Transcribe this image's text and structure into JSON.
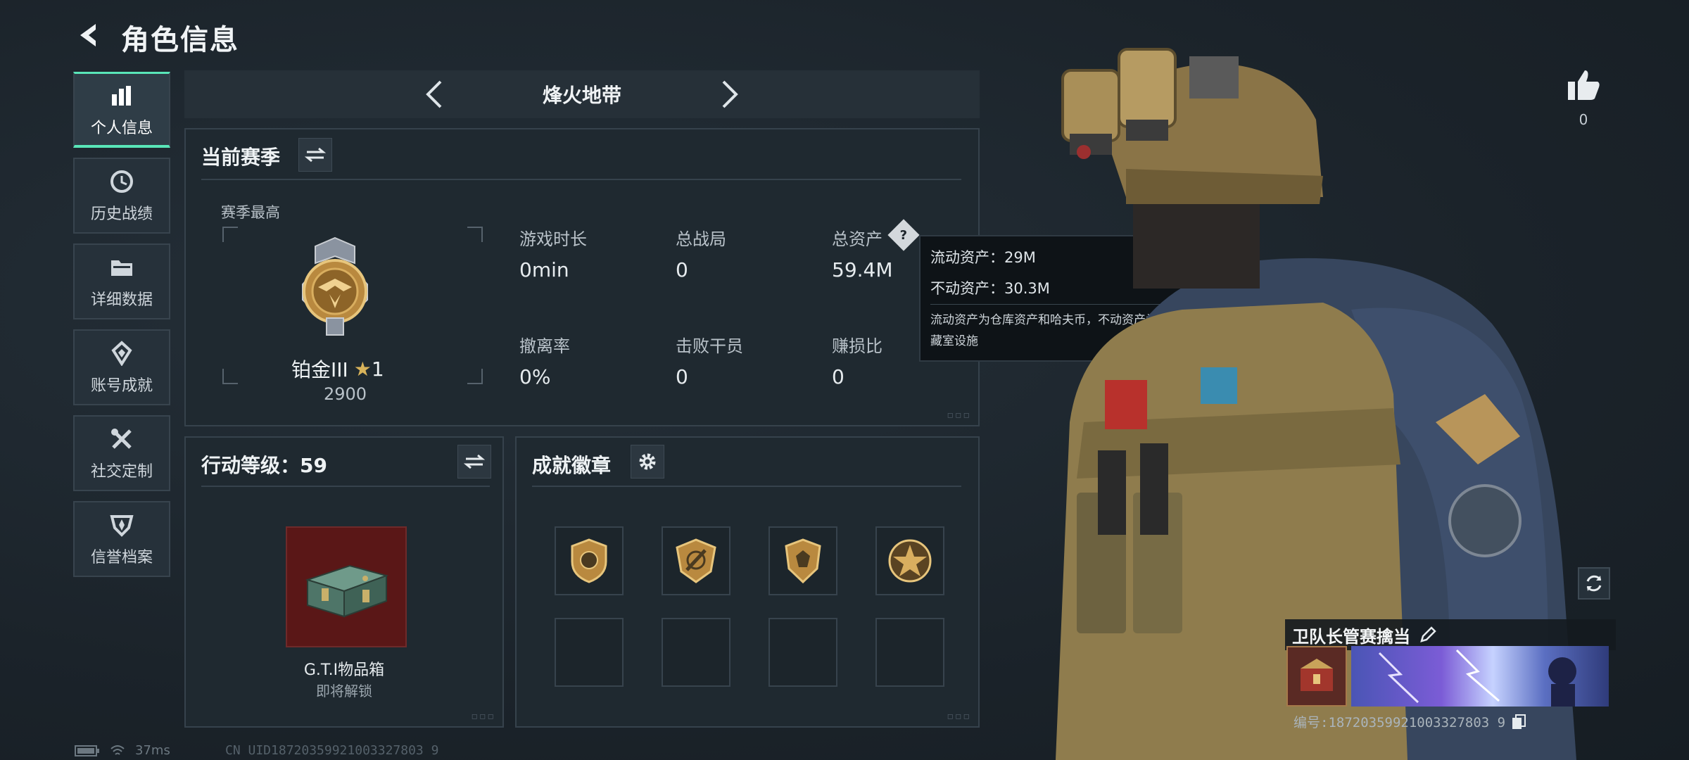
{
  "header": {
    "title": "角色信息",
    "back_icon": "back-arrow-icon"
  },
  "nav": {
    "items": [
      {
        "label": "个人信息",
        "icon": "bar-chart-icon",
        "active": true
      },
      {
        "label": "历史战绩",
        "icon": "clock-icon",
        "active": false
      },
      {
        "label": "详细数据",
        "icon": "folder-icon",
        "active": false
      },
      {
        "label": "账号成就",
        "icon": "achievement-icon",
        "active": false
      },
      {
        "label": "社交定制",
        "icon": "tools-icon",
        "active": false
      },
      {
        "label": "信誉档案",
        "icon": "shield-icon",
        "active": false
      }
    ]
  },
  "mode": {
    "label": "烽火地带"
  },
  "season": {
    "title": "当前赛季",
    "best_label": "赛季最高",
    "rank_name": "铂金III",
    "rank_stars": "1",
    "rank_points": "2900",
    "stats": [
      {
        "label": "游戏时长",
        "value": "0min"
      },
      {
        "label": "总战局",
        "value": "0"
      },
      {
        "label": "总资产",
        "value": "59.4M"
      },
      {
        "label": "撤离率",
        "value": "0%"
      },
      {
        "label": "击败干员",
        "value": "0"
      },
      {
        "label": "赚损比",
        "value": "0"
      }
    ]
  },
  "tooltip": {
    "liquid": "流动资产：29M",
    "fixed": "不动资产：30.3M",
    "desc": "流动资产为仓库资产和哈夫币，不动资产为特勤处设施和收藏室设施"
  },
  "action": {
    "title": "行动等级：59",
    "item_name": "G.T.I物品箱",
    "item_status": "即将解锁"
  },
  "badges": {
    "title": "成就徽章",
    "slots": [
      "badge-emblem-1",
      "badge-emblem-2",
      "badge-emblem-3",
      "badge-emblem-4",
      "empty",
      "empty",
      "empty",
      "empty"
    ]
  },
  "character": {
    "likes": "0",
    "name": "卫队长管赛擒当",
    "uid": "编号:18720359921003327803 9"
  },
  "status_bar": {
    "ping": "37ms",
    "uid": "CN UID18720359921003327803 9"
  },
  "colors": {
    "accent": "#59e6b8",
    "background": "#1b232a",
    "panel": "#1f2930",
    "gold": "#c9a35a"
  }
}
